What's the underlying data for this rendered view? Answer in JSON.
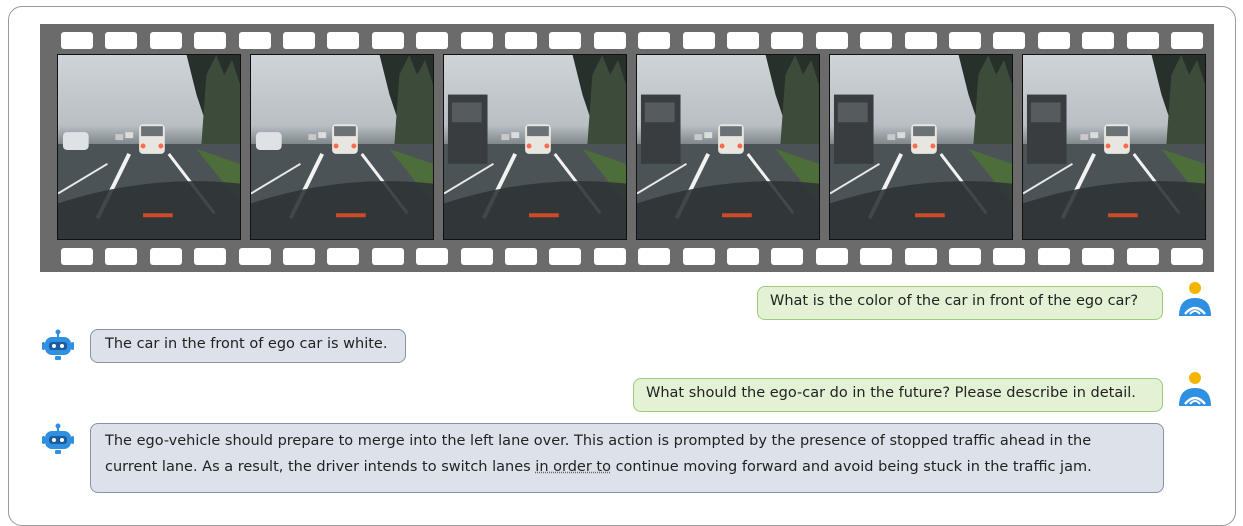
{
  "chat": [
    {
      "role": "user",
      "text": "What is the color of the car in front of the ego car?"
    },
    {
      "role": "bot",
      "text": "The car in the front of ego car is white."
    },
    {
      "role": "user",
      "text": "What should the ego-car do in the future? Please describe in detail."
    },
    {
      "role": "bot",
      "text_a": "The ego-vehicle should prepare to merge into the left lane over. This action is prompted by the presence of stopped traffic ahead in the",
      "text_b1": "current lane. As a result, the driver intends to switch lanes ",
      "text_b2": "in order to",
      "text_b3": " continue moving forward and avoid being stuck in the traffic jam."
    }
  ],
  "colors": {
    "user_bubble": "#e3f1d5",
    "bot_bubble": "#dde2ea",
    "film": "#6b6b6b",
    "bot_icon": "#2f8fe0",
    "user_icon_head": "#f5b400"
  },
  "icons": {
    "user": "user-avatar-icon",
    "bot": "robot-icon"
  }
}
